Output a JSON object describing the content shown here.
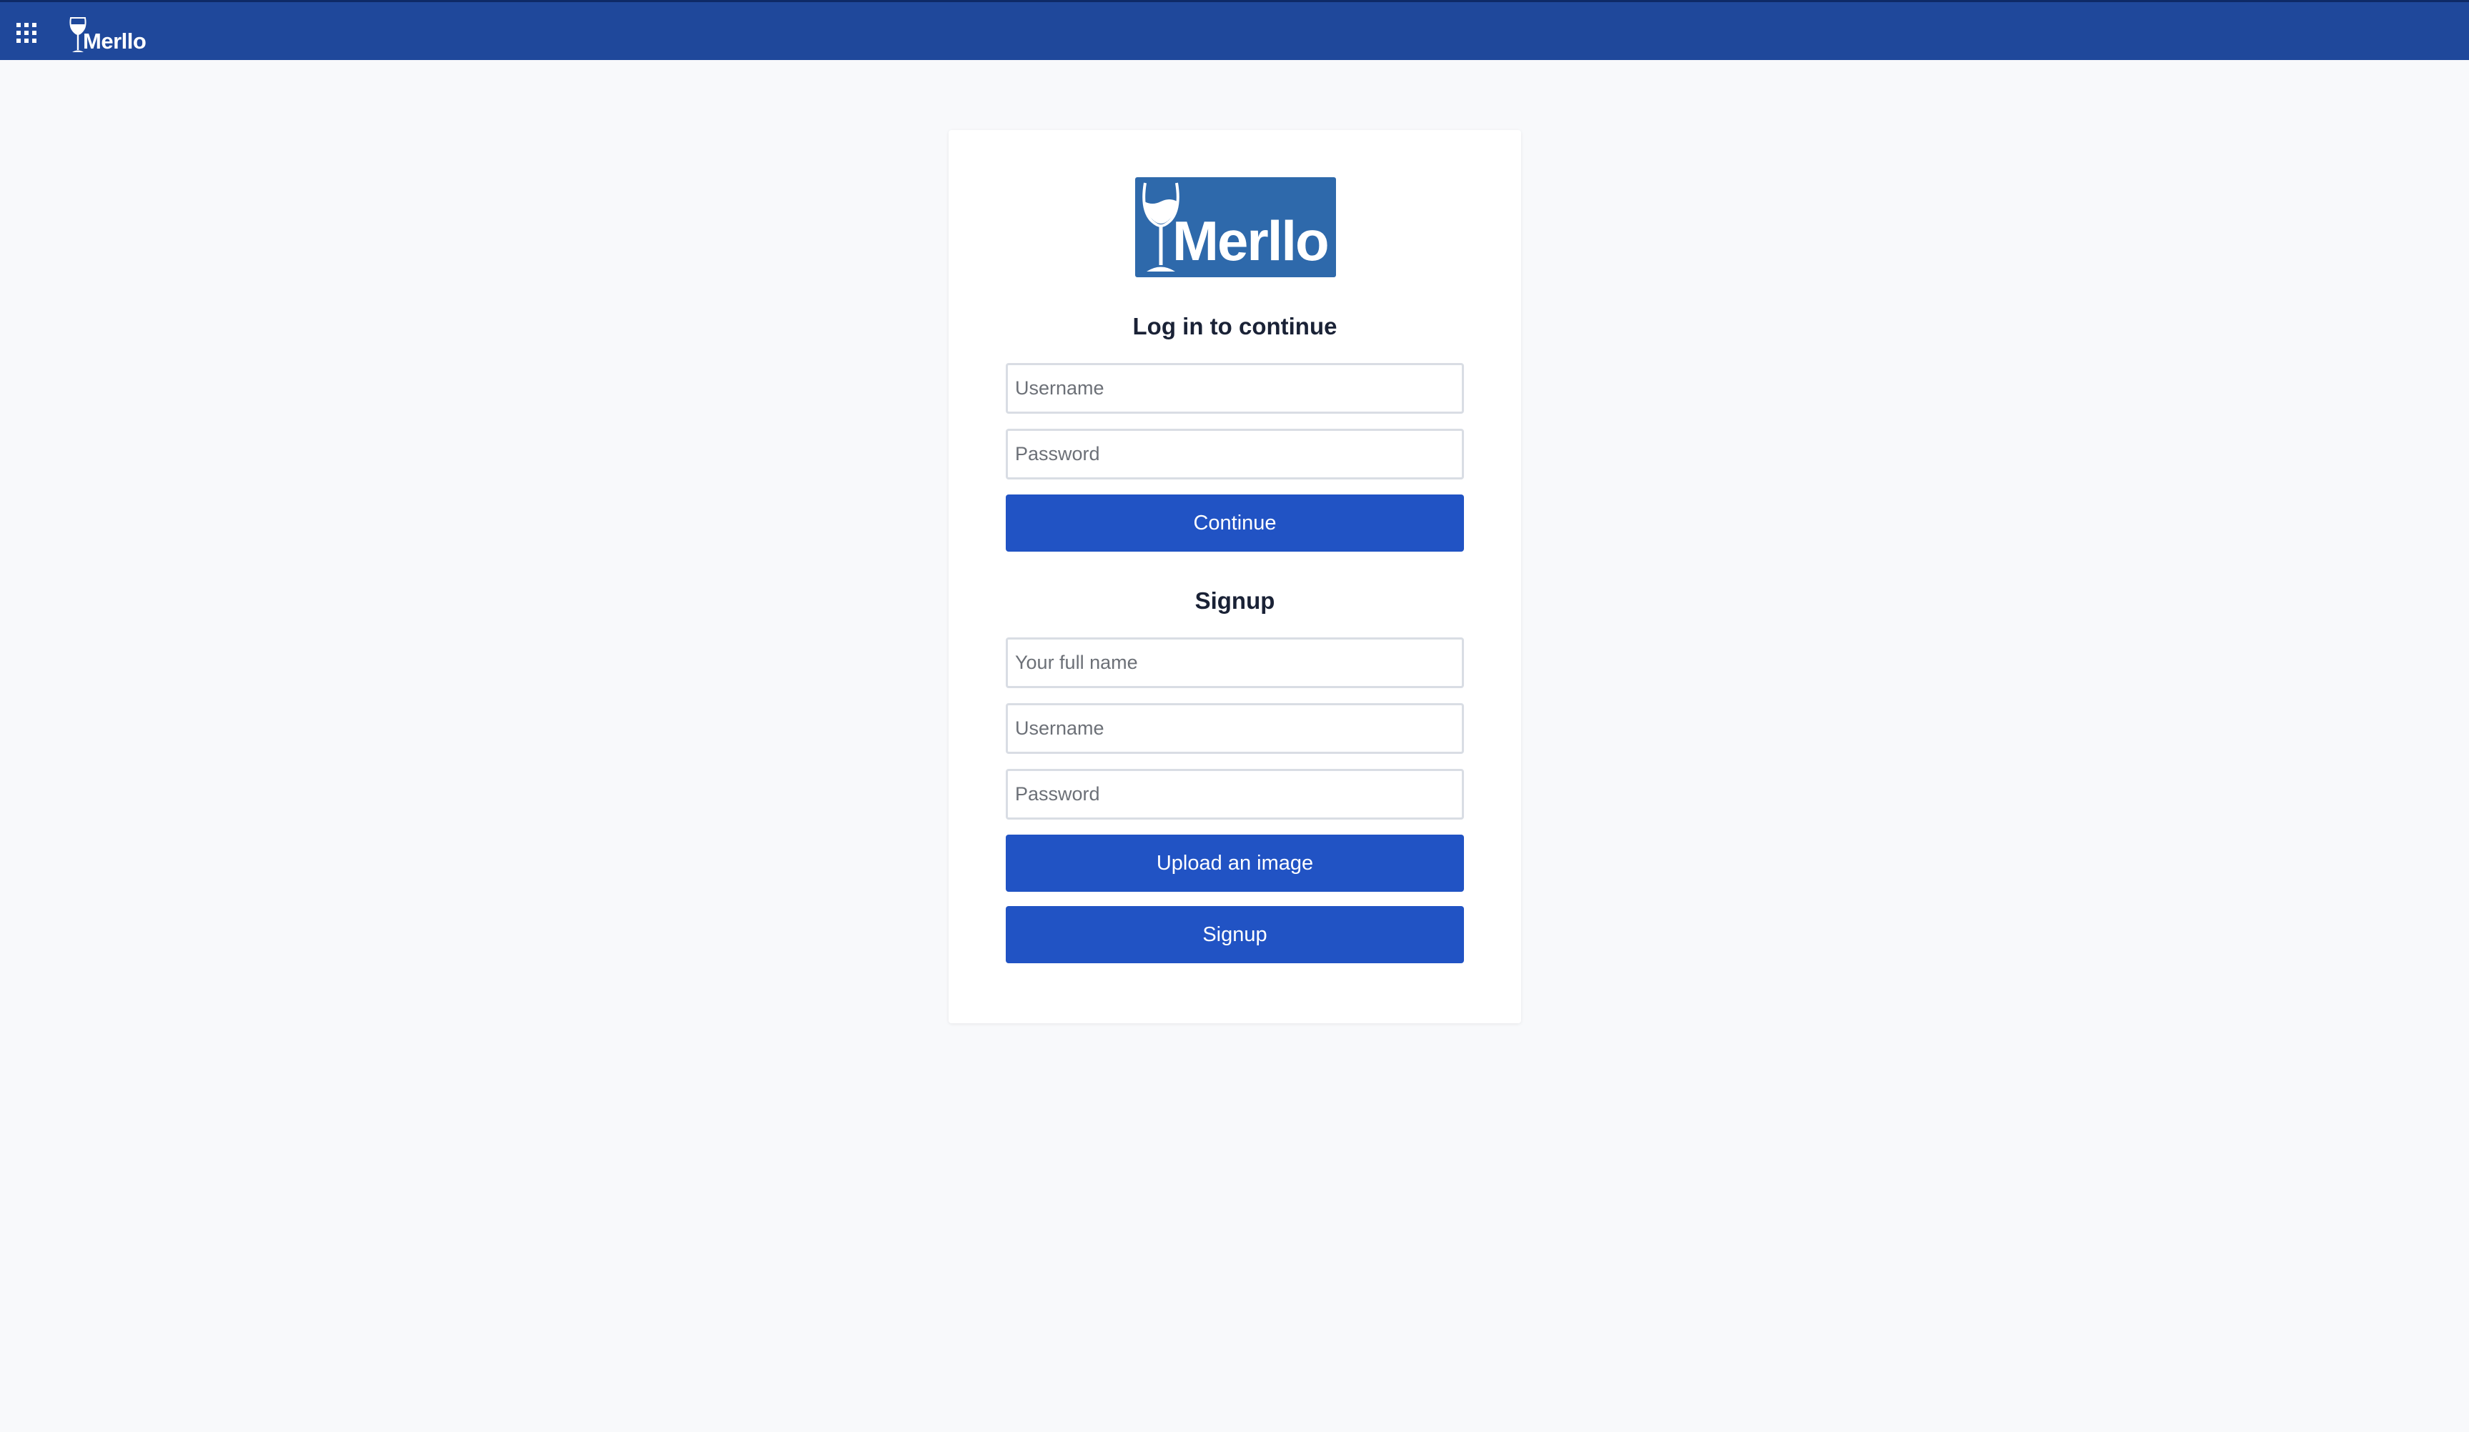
{
  "topbar": {
    "brand": "Merllo",
    "apps_icon": "grid-icon",
    "brand_icon": "wine-glass-icon",
    "background": "#1f489b"
  },
  "card": {
    "logo_text": "Merllo",
    "logo_color": "#2e69ab",
    "login": {
      "heading": "Log in to continue",
      "username_placeholder": "Username",
      "password_placeholder": "Password",
      "continue_label": "Continue"
    },
    "signup": {
      "heading": "Signup",
      "fullname_placeholder": "Your full name",
      "username_placeholder": "Username",
      "password_placeholder": "Password",
      "upload_label": "Upload an image",
      "signup_label": "Signup"
    },
    "button_color": "#2153c4"
  }
}
